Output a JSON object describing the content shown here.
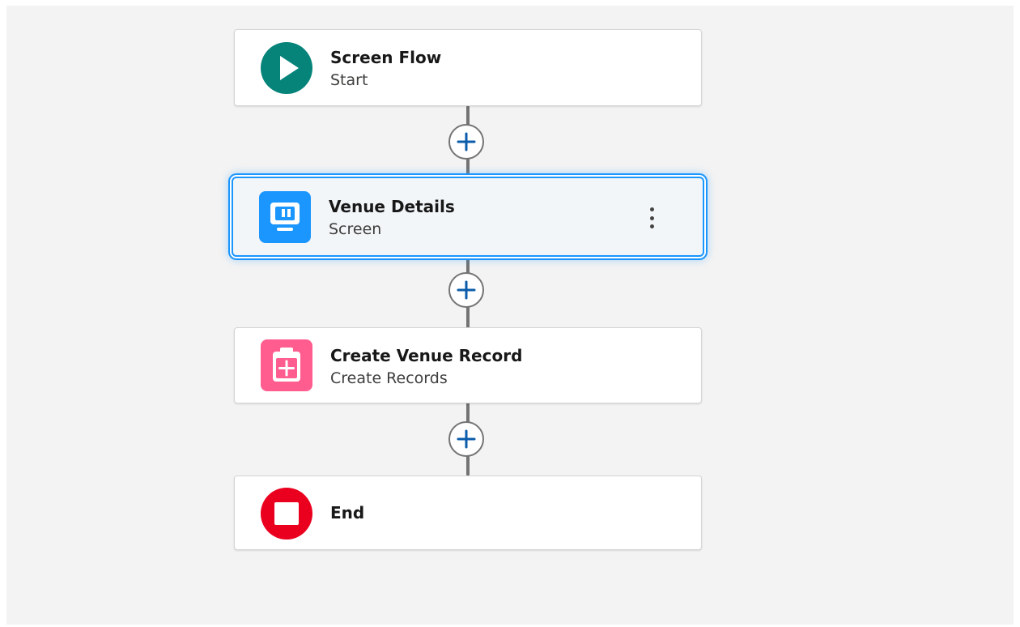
{
  "flow": {
    "start": {
      "title": "Screen Flow",
      "subtitle": "Start",
      "icon": "play-icon",
      "color": "#06847a"
    },
    "screen": {
      "title": "Venue Details",
      "subtitle": "Screen",
      "icon": "screen-icon",
      "color": "#1b96ff",
      "selected": true
    },
    "create": {
      "title": "Create Venue Record",
      "subtitle": "Create Records",
      "icon": "record-create-icon",
      "color": "#ff5d8f"
    },
    "end": {
      "title": "End",
      "icon": "stop-icon",
      "color": "#ea001e"
    }
  },
  "colors": {
    "canvas": "#f3f3f3",
    "connector": "#747474",
    "add_button_plus": "#0b5cab",
    "selection": "#1b96ff"
  }
}
